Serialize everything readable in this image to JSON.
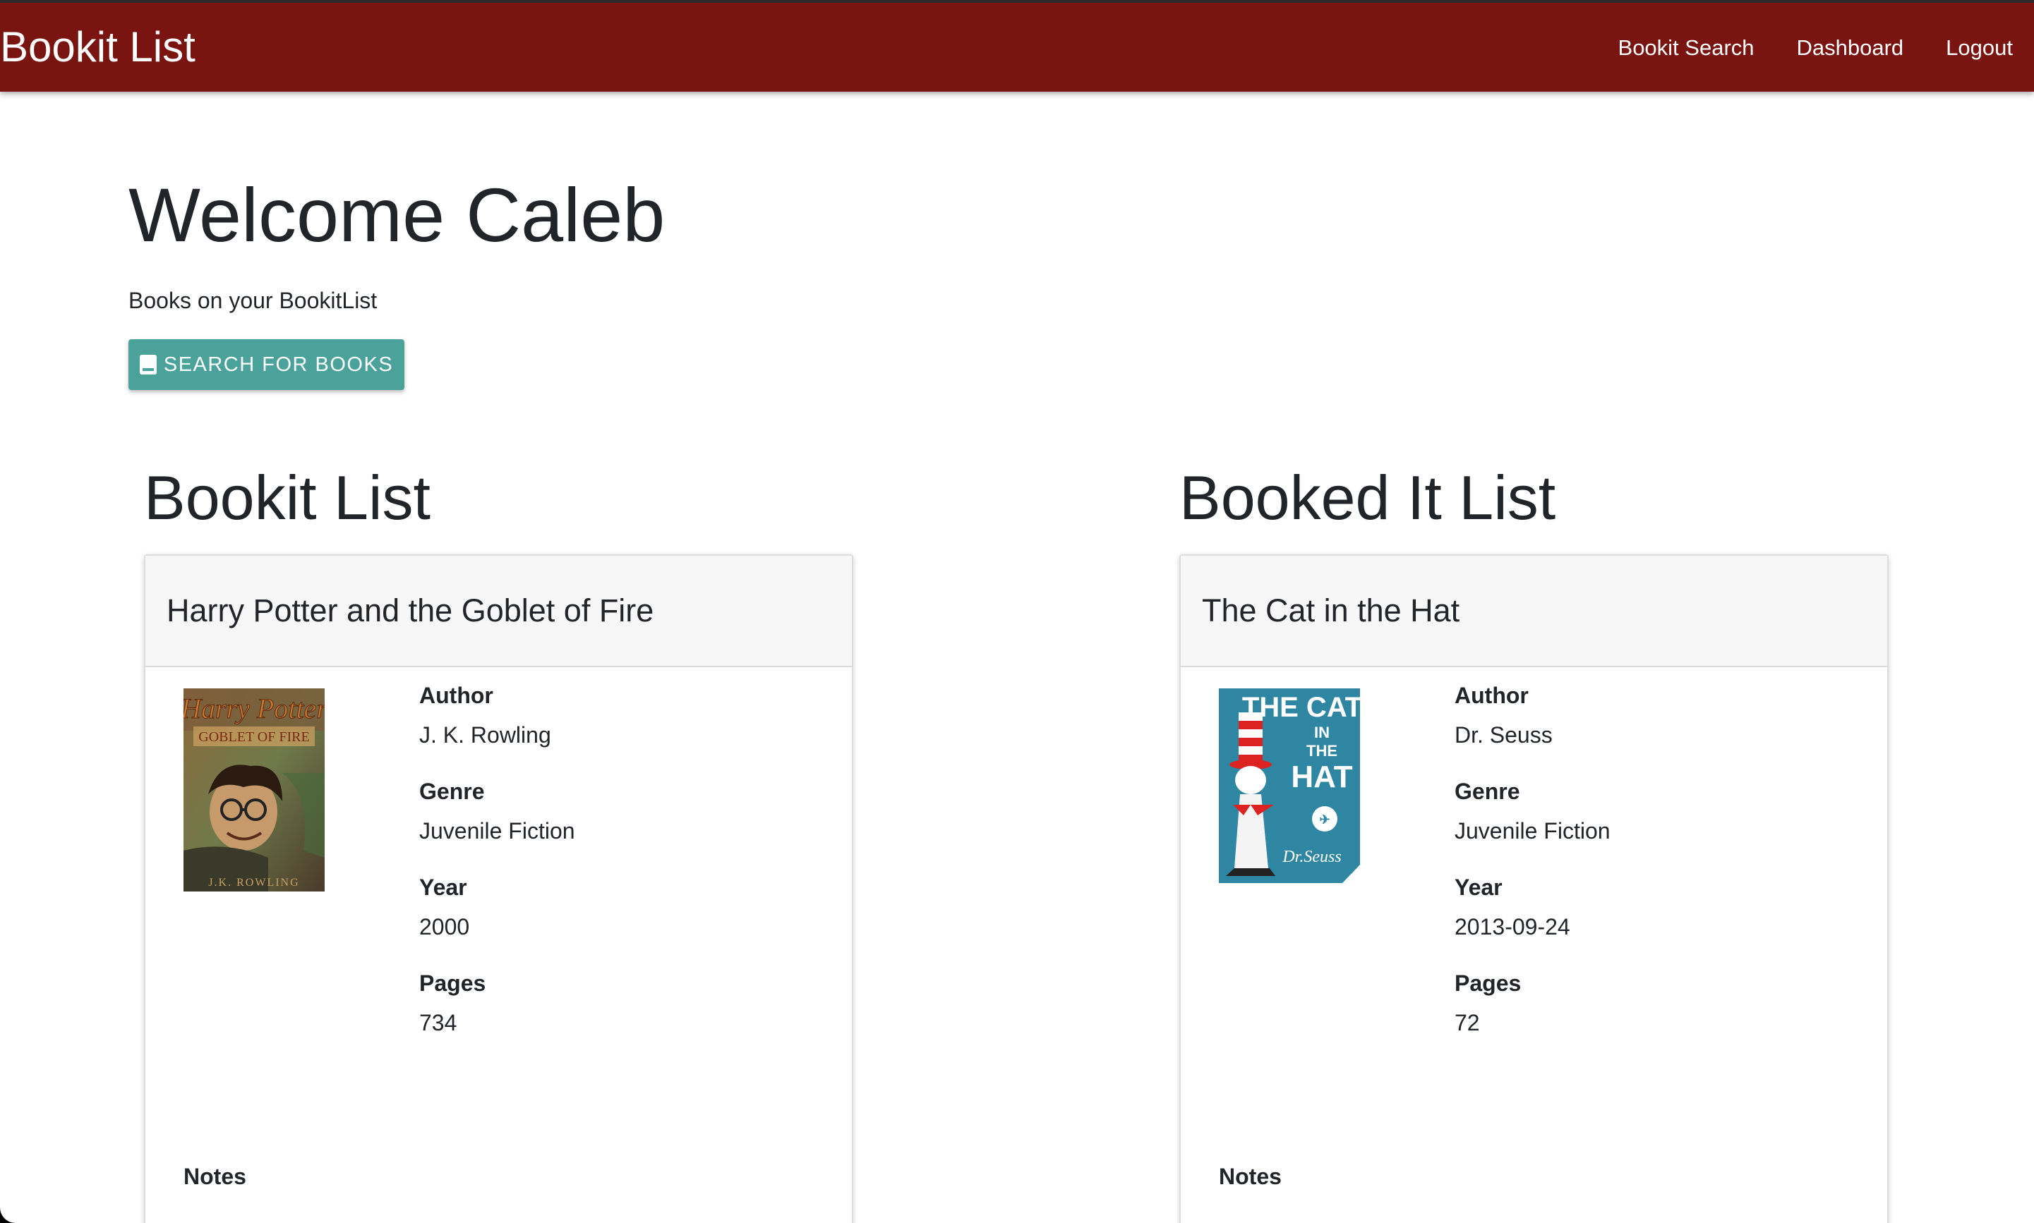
{
  "navbar": {
    "brand": "Bookit List",
    "links": [
      "Bookit Search",
      "Dashboard",
      "Logout"
    ]
  },
  "header": {
    "welcome": "Welcome Caleb",
    "subtitle": "Books on your BookitList",
    "search_button": "SEARCH FOR BOOKS"
  },
  "columns": [
    {
      "title": "Bookit List",
      "book": {
        "title": "Harry Potter and the Goblet of Fire",
        "cover_title": "Harry Potter",
        "cover_subtitle": "GOBLET OF FIRE",
        "cover_author": "J.K. ROWLING",
        "author_label": "Author",
        "author": "J. K. Rowling",
        "genre_label": "Genre",
        "genre": "Juvenile Fiction",
        "year_label": "Year",
        "year": "2000",
        "pages_label": "Pages",
        "pages": "734",
        "notes_label": "Notes"
      }
    },
    {
      "title": "Booked It List",
      "book": {
        "title": "The Cat in the Hat",
        "cover_line1": "THE CAT",
        "cover_line2": "IN",
        "cover_line3": "THE",
        "cover_line4": "HAT",
        "cover_author": "Dr.Seuss",
        "author_label": "Author",
        "author": "Dr. Seuss",
        "genre_label": "Genre",
        "genre": "Juvenile Fiction",
        "year_label": "Year",
        "year": "2013-09-24",
        "pages_label": "Pages",
        "pages": "72",
        "notes_label": "Notes"
      }
    }
  ],
  "colors": {
    "navbar": "#7a1410",
    "button": "#4aa29a",
    "card_header": "#f7f7f7"
  }
}
